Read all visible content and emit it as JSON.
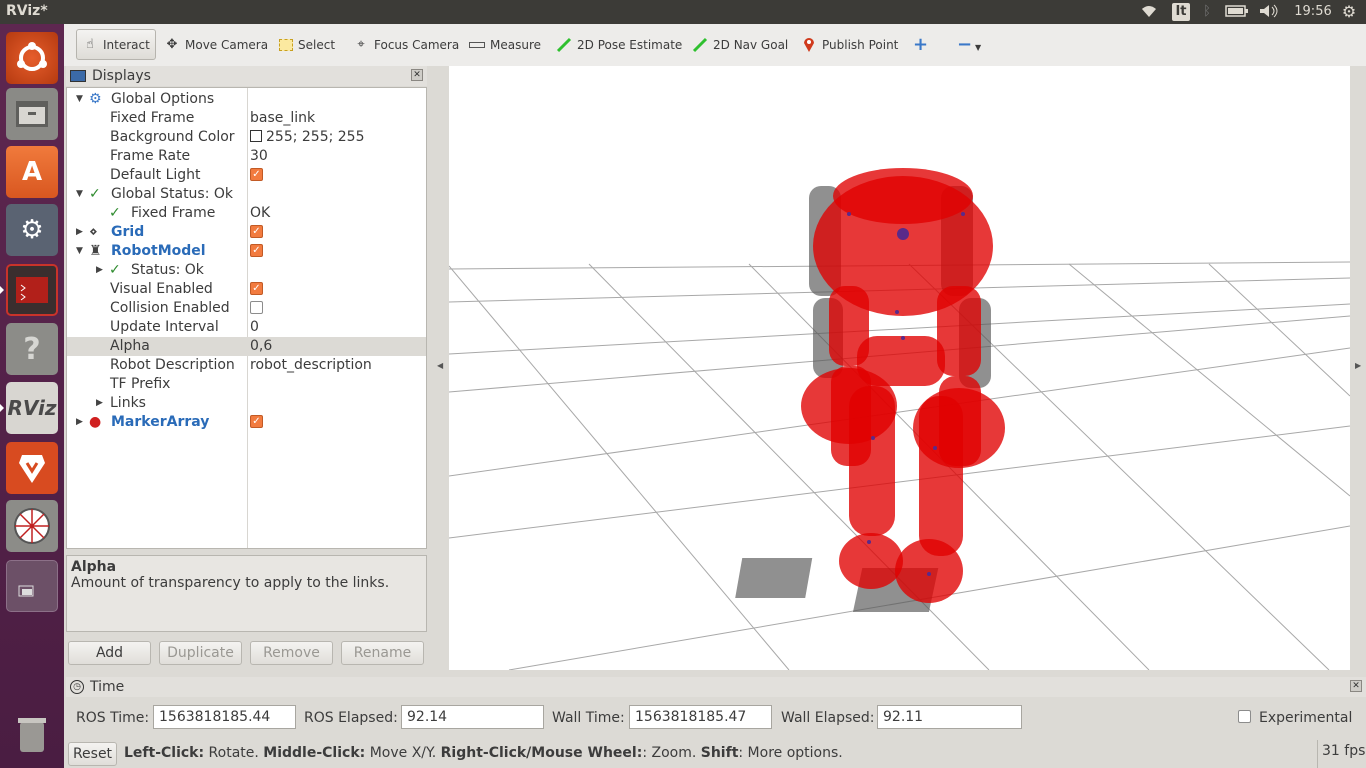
{
  "window": {
    "title": "RViz*"
  },
  "system_tray": {
    "keyboard_layout": "It",
    "time": "19:56"
  },
  "launcher": {
    "items": [
      {
        "name": "ubuntu-dash"
      },
      {
        "name": "files"
      },
      {
        "name": "software-center"
      },
      {
        "name": "system-settings"
      },
      {
        "name": "terminal"
      },
      {
        "name": "help"
      },
      {
        "name": "rviz",
        "label": "RViz"
      },
      {
        "name": "brave-browser"
      },
      {
        "name": "ros-app"
      },
      {
        "name": "workspace-switcher"
      },
      {
        "name": "trash"
      }
    ]
  },
  "toolbar": {
    "tools": [
      {
        "label": "Interact",
        "icon": "hand-icon",
        "active": true
      },
      {
        "label": "Move Camera",
        "icon": "move-camera-icon"
      },
      {
        "label": "Select",
        "icon": "select-box-icon"
      },
      {
        "label": "Focus Camera",
        "icon": "focus-target-icon"
      },
      {
        "label": "Measure",
        "icon": "ruler-icon"
      },
      {
        "label": "2D Pose Estimate",
        "icon": "green-arrow-icon"
      },
      {
        "label": "2D Nav Goal",
        "icon": "green-arrow-icon"
      },
      {
        "label": "Publish Point",
        "icon": "map-pin-icon"
      }
    ],
    "extra_icons": [
      "plus-icon",
      "minus-icon",
      "dropdown-arrow-icon"
    ]
  },
  "displays": {
    "title": "Displays",
    "rows": [
      {
        "depth": 0,
        "expander": "open",
        "icon": "gear",
        "label": "Global Options",
        "value": "",
        "style": "normal"
      },
      {
        "depth": 1,
        "label": "Fixed Frame",
        "value": "base_link"
      },
      {
        "depth": 1,
        "label": "Background Color",
        "value": "255; 255; 255",
        "swatch": "#ffffff"
      },
      {
        "depth": 1,
        "label": "Frame Rate",
        "value": "30"
      },
      {
        "depth": 1,
        "label": "Default Light",
        "check": true
      },
      {
        "depth": 0,
        "expander": "open",
        "icon": "ok",
        "label": "Global Status: Ok",
        "style": "normal"
      },
      {
        "depth": 1,
        "icon": "ok",
        "label": "Fixed Frame",
        "value": "OK"
      },
      {
        "depth": 0,
        "expander": "closed",
        "icon": "grid",
        "label": "Grid",
        "style": "blue",
        "check": true
      },
      {
        "depth": 0,
        "expander": "open",
        "icon": "robot",
        "label": "RobotModel",
        "style": "blue",
        "check": true
      },
      {
        "depth": 1,
        "expander": "closed",
        "icon": "ok",
        "label": "Status: Ok"
      },
      {
        "depth": 1,
        "label": "Visual Enabled",
        "check": true
      },
      {
        "depth": 1,
        "label": "Collision Enabled",
        "check": false
      },
      {
        "depth": 1,
        "label": "Update Interval",
        "value": "0"
      },
      {
        "depth": 1,
        "label": "Alpha",
        "value": "0,6",
        "selected": true
      },
      {
        "depth": 1,
        "label": "Robot Description",
        "value": "robot_description"
      },
      {
        "depth": 1,
        "label": "TF Prefix",
        "value": ""
      },
      {
        "depth": 1,
        "expander": "closed",
        "label": "Links"
      },
      {
        "depth": 0,
        "expander": "closed",
        "icon": "markers",
        "label": "MarkerArray",
        "style": "blue",
        "check": true
      }
    ],
    "description": {
      "title": "Alpha",
      "text": "Amount of transparency to apply to the links."
    },
    "buttons": {
      "add": "Add",
      "duplicate": "Duplicate",
      "remove": "Remove",
      "rename": "Rename"
    }
  },
  "time_panel": {
    "title": "Time",
    "ros_time_label": "ROS Time:",
    "ros_time": "1563818185.44",
    "ros_elapsed_label": "ROS Elapsed:",
    "ros_elapsed": "92.14",
    "wall_time_label": "Wall Time:",
    "wall_time": "1563818185.47",
    "wall_elapsed_label": "Wall Elapsed:",
    "wall_elapsed": "92.11",
    "experimental_label": "Experimental",
    "experimental": false
  },
  "status_bar": {
    "reset": "Reset",
    "hint_left_click": "Left-Click:",
    "hint_rotate": " Rotate. ",
    "hint_middle_click": "Middle-Click:",
    "hint_move": " Move X/Y. ",
    "hint_right_click": "Right-Click/Mouse Wheel:",
    "hint_zoom": ": Zoom. ",
    "hint_shift": "Shift",
    "hint_more": ": More options.",
    "fps": "31 fps"
  },
  "scene": {
    "background": "#ffffff",
    "grid_color": "#a0a0a0",
    "robot_color": "#e00000",
    "robot_frame_color": "#555555"
  }
}
